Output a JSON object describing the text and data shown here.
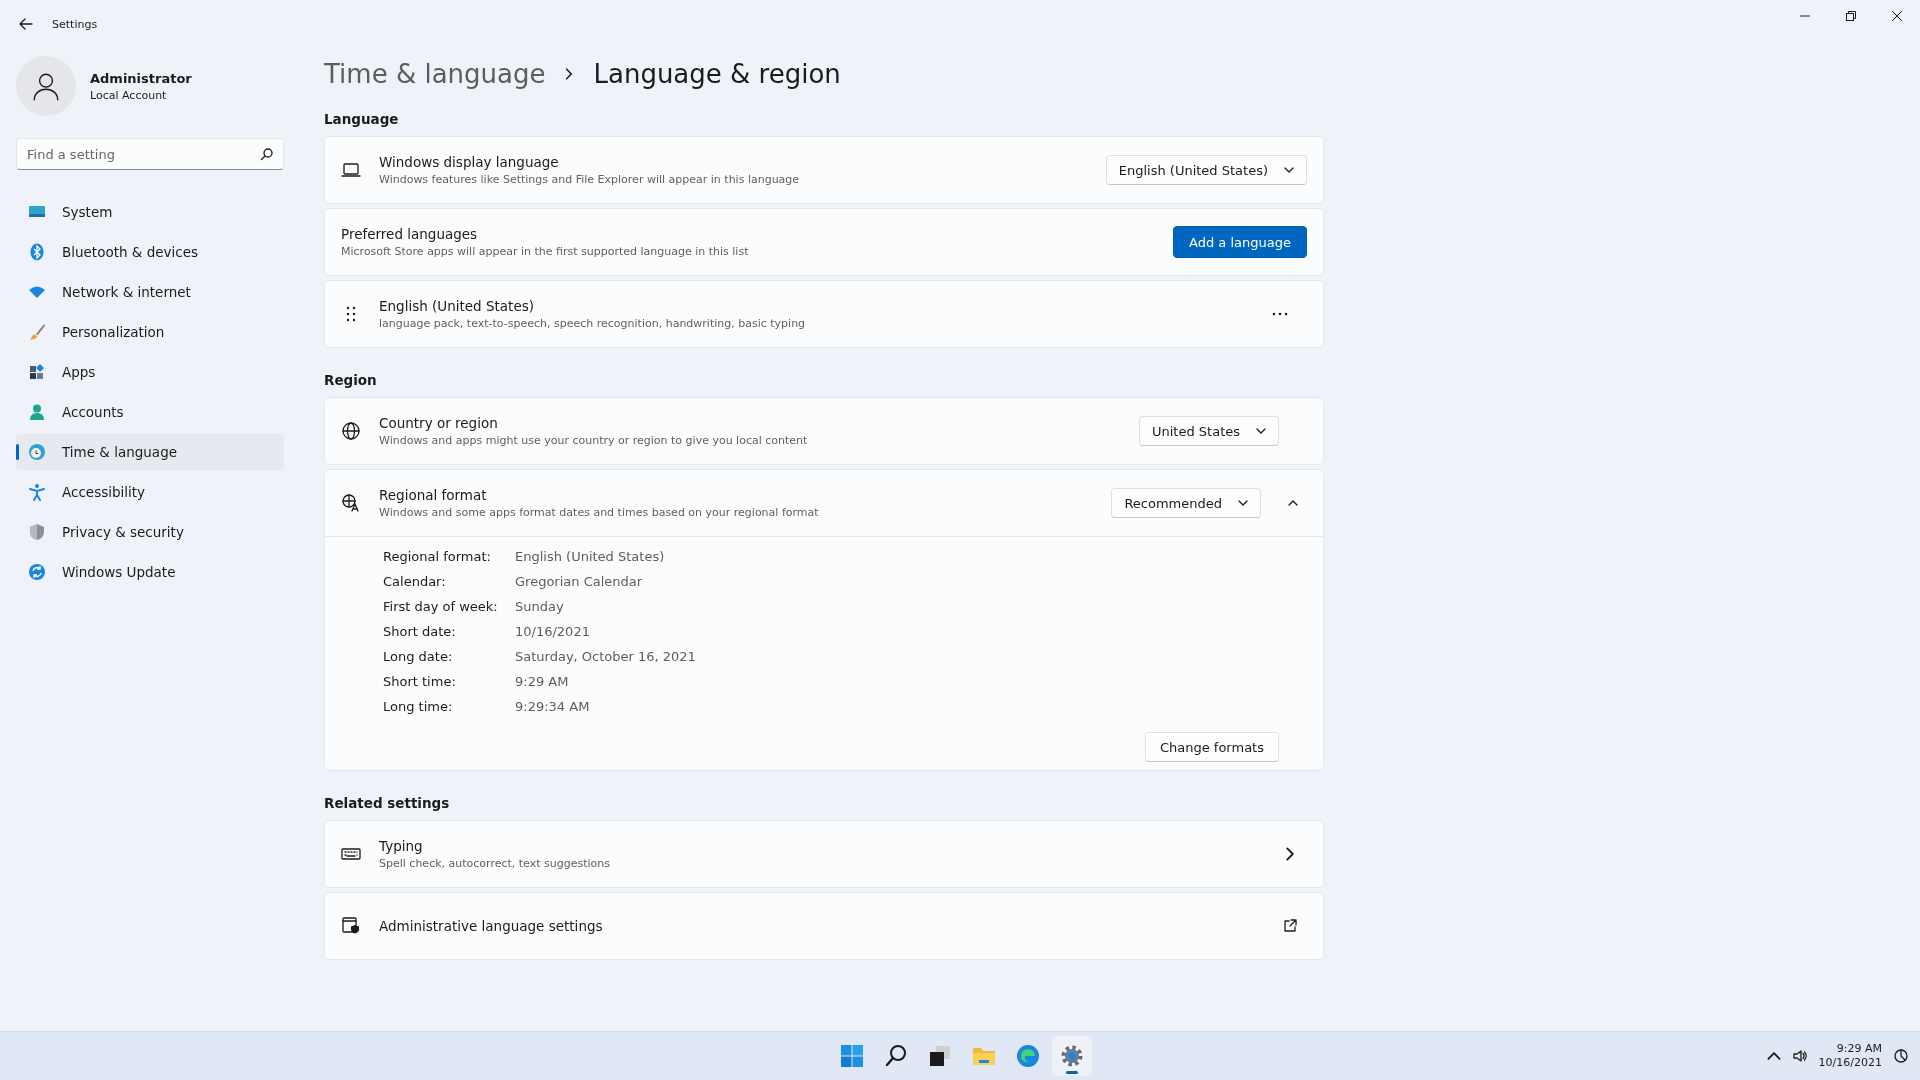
{
  "window": {
    "title": "Settings"
  },
  "user": {
    "name": "Administrator",
    "account": "Local Account"
  },
  "search": {
    "placeholder": "Find a setting"
  },
  "sidebar": {
    "items": [
      {
        "label": "System",
        "kind": "system",
        "selected": false
      },
      {
        "label": "Bluetooth & devices",
        "kind": "bluetooth",
        "selected": false
      },
      {
        "label": "Network & internet",
        "kind": "wifi",
        "selected": false
      },
      {
        "label": "Personalization",
        "kind": "brush",
        "selected": false
      },
      {
        "label": "Apps",
        "kind": "apps",
        "selected": false
      },
      {
        "label": "Accounts",
        "kind": "person",
        "selected": false
      },
      {
        "label": "Time & language",
        "kind": "clock",
        "selected": true
      },
      {
        "label": "Accessibility",
        "kind": "accessibility",
        "selected": false
      },
      {
        "label": "Privacy & security",
        "kind": "shield",
        "selected": false
      },
      {
        "label": "Windows Update",
        "kind": "update",
        "selected": false
      }
    ]
  },
  "breadcrumb": [
    "Time & language",
    "Language & region"
  ],
  "language": {
    "heading": "Language",
    "display_language": {
      "title": "Windows display language",
      "description": "Windows features like Settings and File Explorer will appear in this language",
      "value": "English (United States)"
    },
    "preferred": {
      "title": "Preferred languages",
      "description": "Microsoft Store apps will appear in the first supported language in this list",
      "button": "Add a language"
    },
    "languages": [
      {
        "name": "English (United States)",
        "features": "language pack, text-to-speech, speech recognition, handwriting, basic typing"
      }
    ]
  },
  "region": {
    "heading": "Region",
    "country": {
      "title": "Country or region",
      "description": "Windows and apps might use your country or region to give you local content",
      "value": "United States"
    },
    "regional_format": {
      "title": "Regional format",
      "description": "Windows and some apps format dates and times based on your regional format",
      "value": "Recommended",
      "expanded": true,
      "details": [
        {
          "label": "Regional format:",
          "value": "English (United States)"
        },
        {
          "label": "Calendar:",
          "value": "Gregorian Calendar"
        },
        {
          "label": "First day of week:",
          "value": "Sunday"
        },
        {
          "label": "Short date:",
          "value": "10/16/2021"
        },
        {
          "label": "Long date:",
          "value": "Saturday, October 16, 2021"
        },
        {
          "label": "Short time:",
          "value": "9:29 AM"
        },
        {
          "label": "Long time:",
          "value": "9:29:34 AM"
        }
      ],
      "button": "Change formats"
    }
  },
  "related": {
    "heading": "Related settings",
    "items": [
      {
        "title": "Typing",
        "description": "Spell check, autocorrect, text suggestions",
        "kind": "chevron"
      },
      {
        "title": "Administrative language settings",
        "kind": "external"
      }
    ]
  },
  "taskbar": {
    "apps": [
      {
        "kind": "start",
        "selected": false
      },
      {
        "kind": "search",
        "selected": false
      },
      {
        "kind": "taskview",
        "selected": false
      },
      {
        "kind": "folder",
        "selected": false
      },
      {
        "kind": "browser",
        "selected": false
      },
      {
        "kind": "gear",
        "selected": true
      }
    ],
    "time": "9:29 AM",
    "date": "10/16/2021"
  }
}
